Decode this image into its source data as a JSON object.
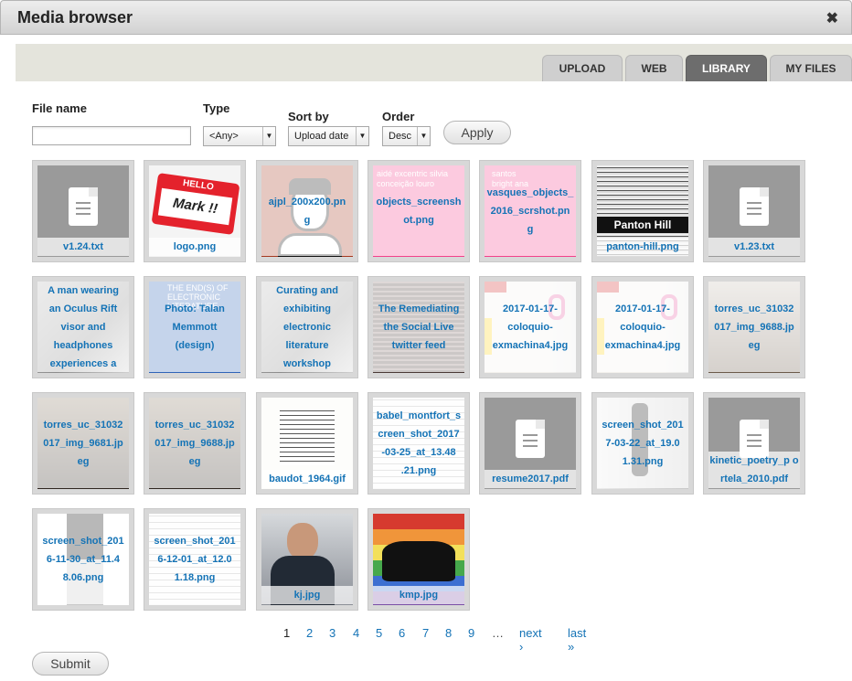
{
  "dialog": {
    "title": "Media browser"
  },
  "tabs": [
    {
      "label": "UPLOAD",
      "active": false
    },
    {
      "label": "WEB",
      "active": false
    },
    {
      "label": "LIBRARY",
      "active": true
    },
    {
      "label": "MY FILES",
      "active": false
    }
  ],
  "filters": {
    "file_name_label": "File name",
    "file_name_value": "",
    "type_label": "Type",
    "type_value": "<Any>",
    "sort_label": "Sort by",
    "sort_value": "Upload date",
    "order_label": "Order",
    "order_value": "Desc",
    "apply_label": "Apply"
  },
  "media": [
    {
      "name": "v1.24.txt",
      "kind": "doc"
    },
    {
      "name": "logo.png",
      "kind": "logo"
    },
    {
      "name": "ajpl_200x200.png",
      "kind": "ajpl"
    },
    {
      "name": "objects_screenshot.png",
      "kind": "pink"
    },
    {
      "name": "vasques_objects_2016_scrshot.png",
      "kind": "pink2"
    },
    {
      "name": "panton-hill.png",
      "kind": "news"
    },
    {
      "name": "v1.23.txt",
      "kind": "doc"
    },
    {
      "name": "A man wearing an Oculus Rift visor and headphones experiences a",
      "kind": "photo_grey"
    },
    {
      "name": "Photo: Talan Memmott (design)",
      "kind": "blue"
    },
    {
      "name": "Curating and exhibiting electronic literature workshop",
      "kind": "photo_grey"
    },
    {
      "name": "The Remediating the Social Live twitter feed",
      "kind": "dark"
    },
    {
      "name": "2017-01-17-coloquio-exmachina4.jpg",
      "kind": "poster"
    },
    {
      "name": "2017-01-17-coloquio-exmachina4.jpg",
      "kind": "poster"
    },
    {
      "name": "torres_uc_31032017_img_9688.jpeg",
      "kind": "room"
    },
    {
      "name": "torres_uc_31032017_img_9681.jpeg",
      "kind": "room_dark"
    },
    {
      "name": "torres_uc_31032017_img_9688.jpeg",
      "kind": "room_dark"
    },
    {
      "name": "baudot_1964.gif",
      "kind": "paper"
    },
    {
      "name": "babel_montfort_screen_shot_2017-03-25_at_13.48.21.png",
      "kind": "paper2"
    },
    {
      "name": "resume2017.pdf",
      "kind": "doc"
    },
    {
      "name": "screen_shot_2017-03-22_at_19.01.31.png",
      "kind": "bw"
    },
    {
      "name": "kinetic_poetry_portela_2010.pdf",
      "kind": "doc"
    },
    {
      "name": "screen_shot_2016-11-30_at_11.48.06.png",
      "kind": "blackbar"
    },
    {
      "name": "screen_shot_2016-12-01_at_12.01.18.png",
      "kind": "paper2"
    },
    {
      "name": "kj.jpg",
      "kind": "man"
    },
    {
      "name": "kmp.jpg",
      "kind": "rainbow"
    }
  ],
  "captions": [
    "v1.24.txt",
    "logo.png",
    "ajpl_200x200.pn g",
    "objects_screensh ot.png",
    "vasques_objects_ 2016_scrshot.pn g",
    "panton-hill.png",
    "v1.23.txt",
    "A man wearing an Oculus Rift visor and headphones experiences a",
    "Photo: Talan Memmott (design)",
    "Curating and exhibiting electronic literature workshop",
    "The Remediating the Social Live twitter feed",
    "2017-01-17- coloquio- exmachina4.jpg",
    "2017-01-17- coloquio- exmachina4.jpg",
    "torres_uc_31032 017_img_9688.jp eg",
    "torres_uc_31032 017_img_9681.jp eg",
    "torres_uc_31032 017_img_9688.jp eg",
    "baudot_1964.gif",
    "babel_montfort_s creen_shot_2017 -03-25_at_13.48 .21.png",
    "resume2017.pdf",
    "screen_shot_201 7-03-22_at_19.0 1.31.png",
    "kinetic_poetry_p ortela_2010.pdf",
    "screen_shot_201 6-11-30_at_11.4 8.06.png",
    "screen_shot_201 6-12-01_at_12.0 1.18.png",
    "kj.jpg",
    "kmp.jpg"
  ],
  "thumb_text": {
    "hello": "HELLO",
    "mark": "Mark !!",
    "pink_words": "aidé excentric silvia conceição louro",
    "pink2_words": "santos bright ana",
    "news_words": "Panton Hill",
    "blue_words": "THE END(S) OF ELECTRONIC LITERATURE"
  },
  "pager": {
    "current": "1",
    "pages": [
      "2",
      "3",
      "4",
      "5",
      "6",
      "7",
      "8",
      "9"
    ],
    "ellipsis": "…",
    "next": "next ›",
    "last": "last »"
  },
  "submit_label": "Submit",
  "colors": {
    "link": "#1473b6",
    "tab_active": "#6d6d6d",
    "pink": "#f2418b"
  }
}
